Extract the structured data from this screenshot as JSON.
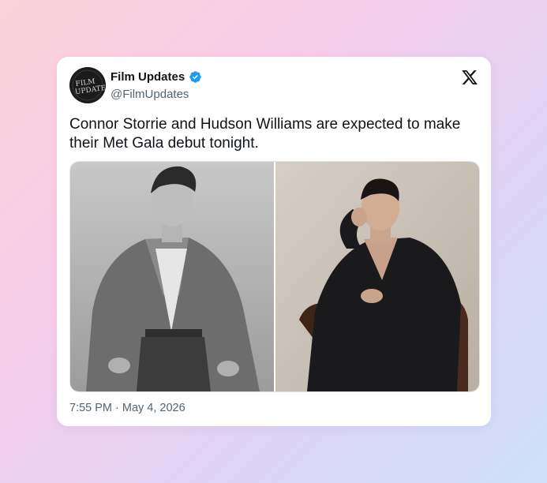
{
  "post": {
    "avatar_logo_text": "FILM UPDATES",
    "display_name": "Film Updates",
    "verified_badge": "verified-badge-icon",
    "handle": "@FilmUpdates",
    "platform_icon": "x-logo-icon",
    "text": "Connor Storrie and Hudson Williams are expected to make their Met Gala debut tonight.",
    "media": [
      {
        "name": "photo-left",
        "description_icon": "black-and-white-portrait"
      },
      {
        "name": "photo-right",
        "description_icon": "color-portrait"
      }
    ],
    "timestamp": "7:55 PM · May 4, 2026"
  },
  "colors": {
    "verified_blue": "#1d9bf0",
    "text_primary": "#0f1419",
    "text_secondary": "#536471",
    "card_bg": "#ffffff"
  }
}
